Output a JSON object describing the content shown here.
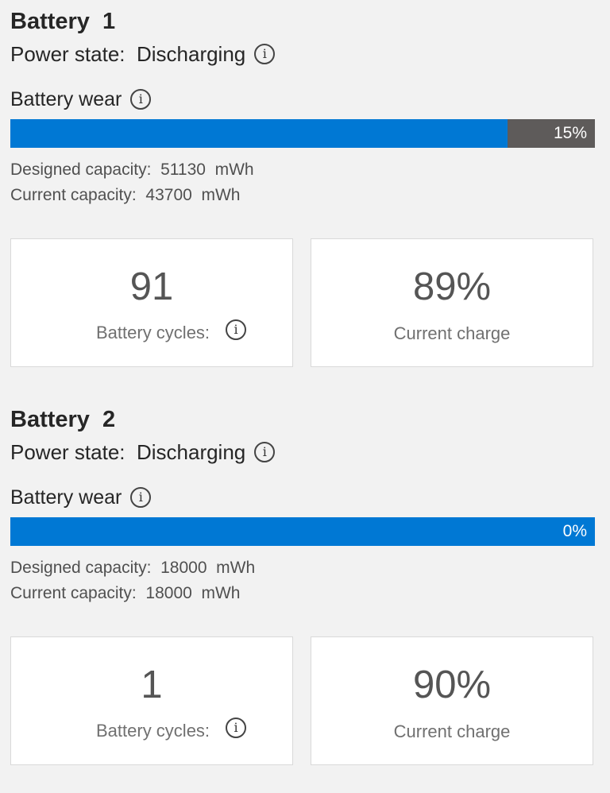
{
  "labels": {
    "power_state": "Power state:",
    "battery_wear": "Battery wear",
    "designed_capacity": "Designed capacity:",
    "current_capacity": "Current capacity:",
    "battery_cycles": "Battery cycles:",
    "current_charge": "Current charge",
    "info_glyph": "i"
  },
  "colors": {
    "wear_fill": "#0078d4",
    "wear_remaining": "#5e5b5a",
    "background": "#f2f2f2"
  },
  "icons": [
    "info-icon"
  ],
  "batteries": [
    {
      "title": "Battery  1",
      "power_state": "Discharging",
      "wear_percent_label": "15%",
      "wear_fraction": 0.15,
      "designed_capacity": "51130  mWh",
      "current_capacity": "43700  mWh",
      "cycles": "91",
      "current_charge": "89%"
    },
    {
      "title": "Battery  2",
      "power_state": "Discharging",
      "wear_percent_label": "0%",
      "wear_fraction": 0.0,
      "designed_capacity": "18000  mWh",
      "current_capacity": "18000  mWh",
      "cycles": "1",
      "current_charge": "90%"
    }
  ]
}
